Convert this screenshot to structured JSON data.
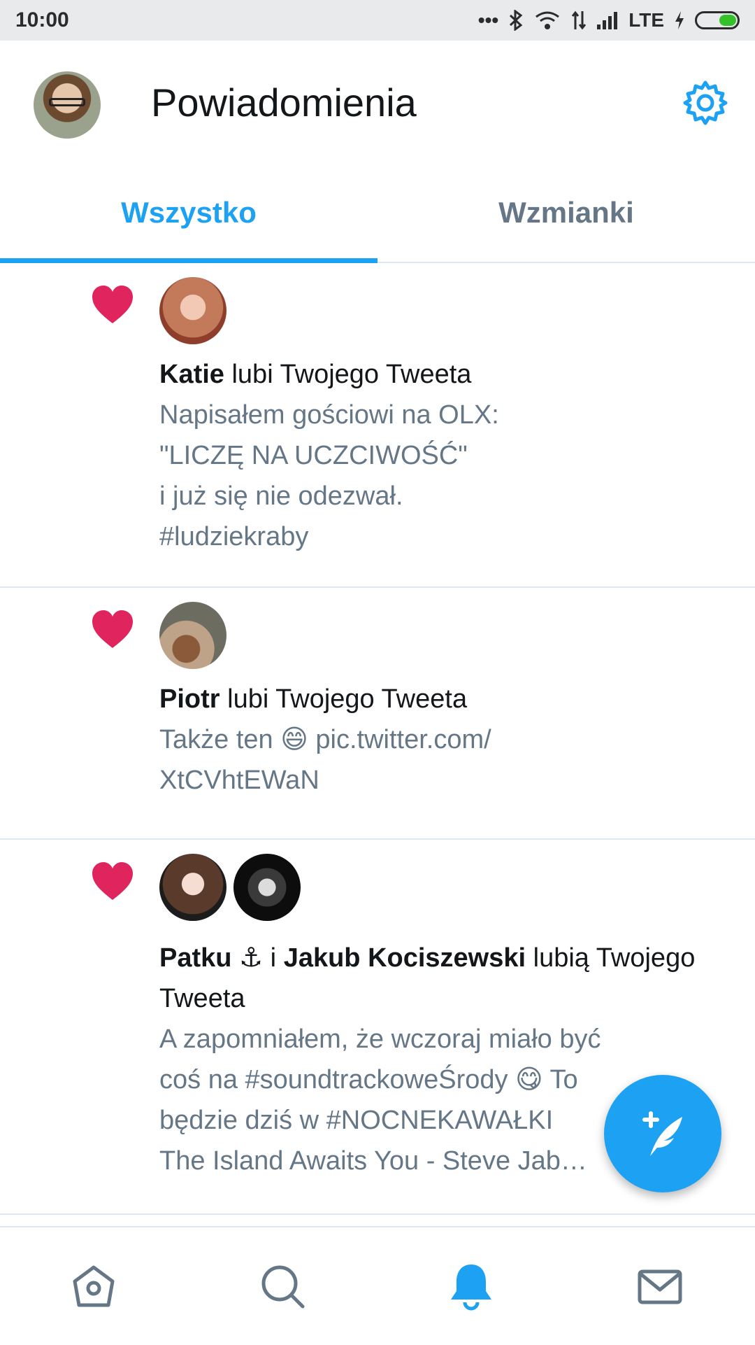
{
  "status_bar": {
    "time": "10:00",
    "network": "LTE"
  },
  "header": {
    "title": "Powiadomienia",
    "settings_icon": "gear-icon"
  },
  "tabs": [
    {
      "label": "Wszystko",
      "active": true
    },
    {
      "label": "Wzmianki",
      "active": false
    }
  ],
  "notifications": [
    {
      "actors": [
        "Katie"
      ],
      "action": "lubi Twojego Tweeta",
      "tweet": "Napisałem gościowi na OLX:\n\"LICZĘ NA UCZCIWOŚĆ\"\ni już się nie odezwał.\n#ludziekraby"
    },
    {
      "actors": [
        "Piotr"
      ],
      "action": "lubi Twojego Tweeta",
      "tweet": "Także ten 😄 pic.twitter.com/\nXtCVhtEWaN"
    },
    {
      "actors": [
        "Patku ⚓",
        "Jakub Kociszewski"
      ],
      "joiner": "i",
      "action": "lubią Twojego Tweeta",
      "tweet": "A zapomniałem, że wczoraj miało być\ncoś na #soundtrackoweŚrody 😋 To\nbędzie dziś w #NOCNEKAWAŁKI\nThe Island Awaits You - Steve Jab…"
    }
  ],
  "colors": {
    "accent": "#1da1f2",
    "like": "#e0245e",
    "secondary_text": "#657786"
  },
  "bottom_nav": {
    "items": [
      "home-icon",
      "search-icon",
      "notifications-icon",
      "messages-icon"
    ],
    "active": "notifications-icon"
  }
}
